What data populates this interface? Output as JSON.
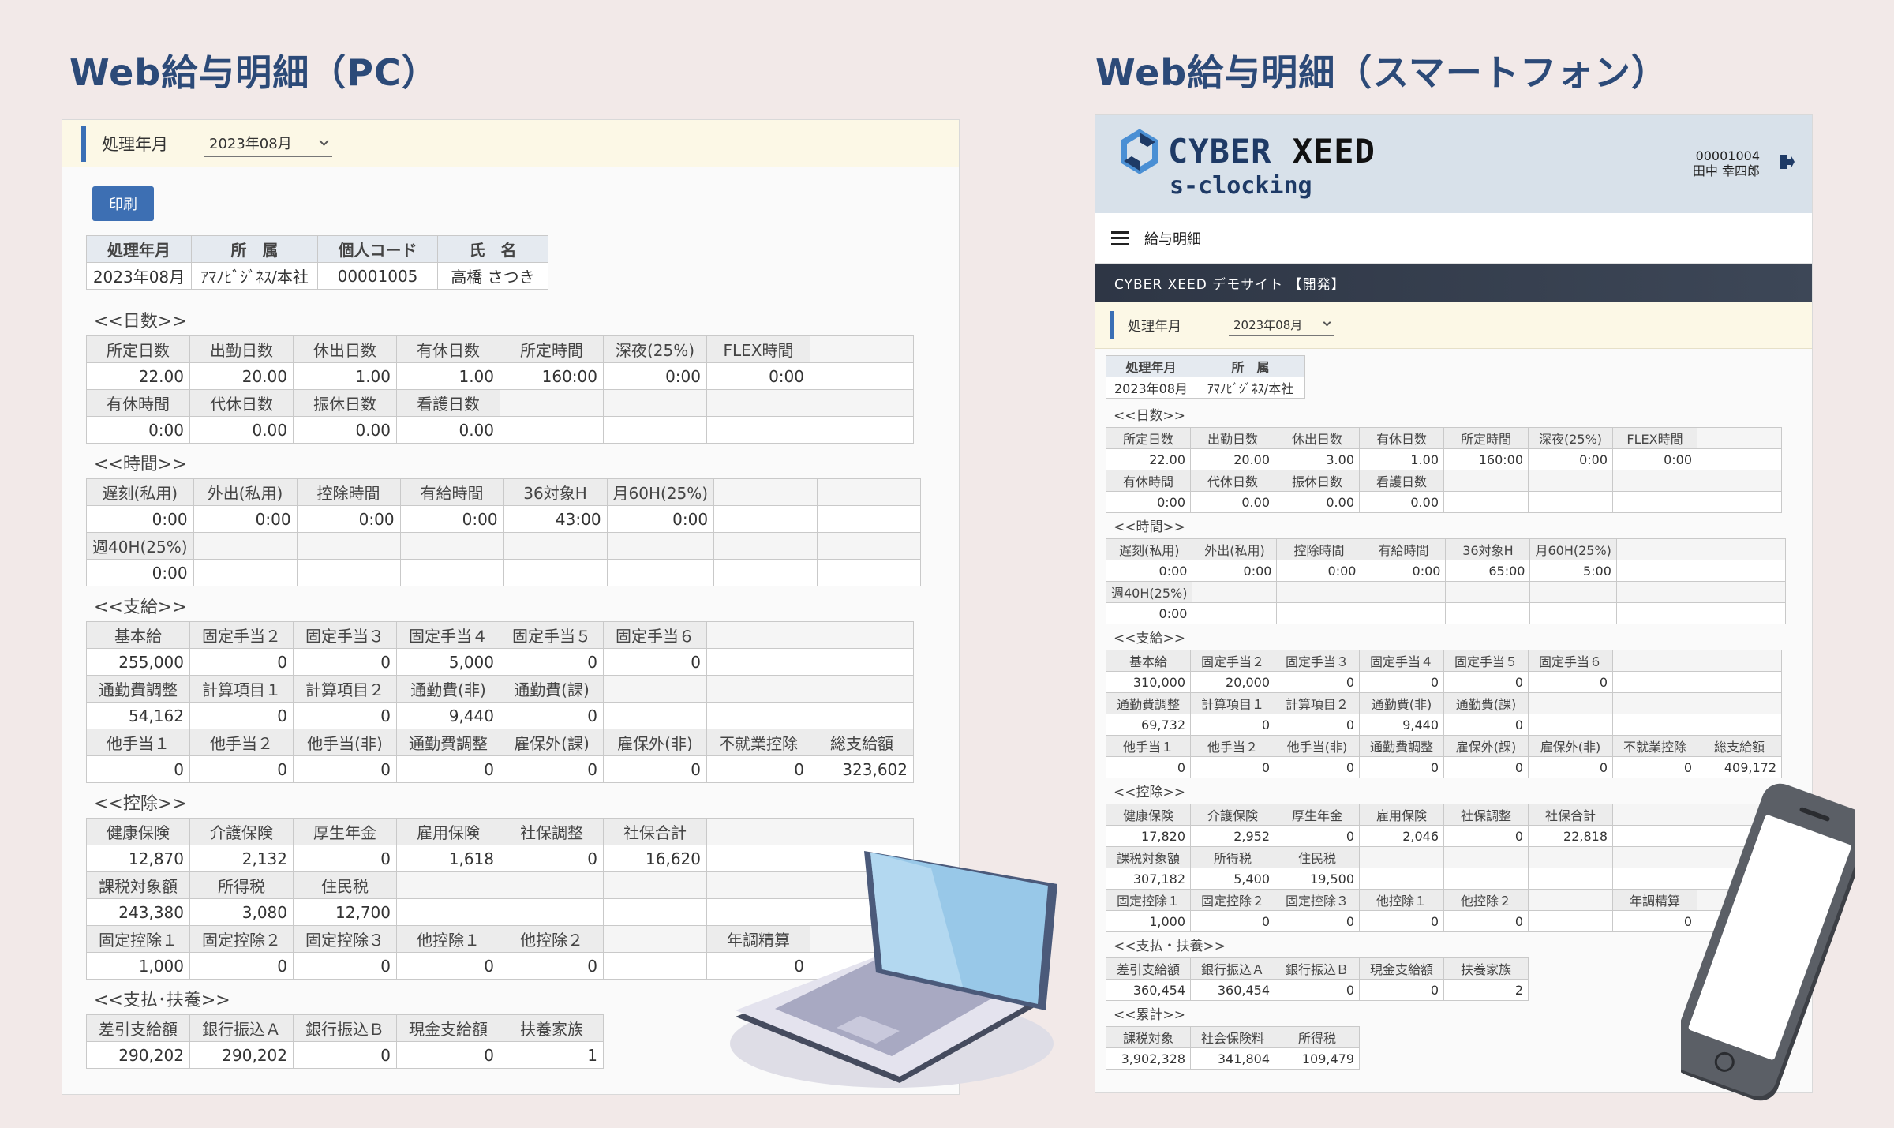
{
  "headings": {
    "pc": "Web給与明細（PC）",
    "sp": "Web給与明細（スマートフォン）"
  },
  "pc": {
    "period_label": "処理年月",
    "period_value": "2023年08月",
    "print_button": "印刷",
    "info": {
      "headers": [
        "処理年月",
        "所　属",
        "個人コード",
        "氏　名"
      ],
      "values": [
        "2023年08月",
        "ｱﾏﾉﾋﾞｼﾞﾈｽ/本社",
        "00001005",
        "高橋 さつき"
      ]
    },
    "sections": [
      {
        "title": "<<日数>>",
        "rows": [
          [
            "所定日数",
            "出勤日数",
            "休出日数",
            "有休日数",
            "所定時間",
            "深夜(25%)",
            "FLEX時間",
            ""
          ],
          [
            "22.00",
            "20.00",
            "1.00",
            "1.00",
            "160:00",
            "0:00",
            "0:00",
            ""
          ],
          [
            "有休時間",
            "代休日数",
            "振休日数",
            "看護日数",
            "",
            "",
            "",
            ""
          ],
          [
            "0:00",
            "0.00",
            "0.00",
            "0.00",
            "",
            "",
            "",
            ""
          ]
        ]
      },
      {
        "title": "<<時間>>",
        "rows": [
          [
            "遅刻(私用)",
            "外出(私用)",
            "控除時間",
            "有給時間",
            "36対象H",
            "月60H(25%)",
            "",
            ""
          ],
          [
            "0:00",
            "0:00",
            "0:00",
            "0:00",
            "43:00",
            "0:00",
            "",
            ""
          ],
          [
            "週40H(25%)",
            "",
            "",
            "",
            "",
            "",
            "",
            ""
          ],
          [
            "0:00",
            "",
            "",
            "",
            "",
            "",
            "",
            ""
          ]
        ]
      },
      {
        "title": "<<支給>>",
        "rows": [
          [
            "基本給",
            "固定手当２",
            "固定手当３",
            "固定手当４",
            "固定手当５",
            "固定手当６",
            "",
            ""
          ],
          [
            "255,000",
            "0",
            "0",
            "5,000",
            "0",
            "0",
            "",
            ""
          ],
          [
            "通勤費調整",
            "計算項目１",
            "計算項目２",
            "通勤費(非)",
            "通勤費(課)",
            "",
            "",
            ""
          ],
          [
            "54,162",
            "0",
            "0",
            "9,440",
            "0",
            "",
            "",
            ""
          ],
          [
            "他手当１",
            "他手当２",
            "他手当(非)",
            "通勤費調整",
            "雇保外(課)",
            "雇保外(非)",
            "不就業控除",
            "総支給額"
          ],
          [
            "0",
            "0",
            "0",
            "0",
            "0",
            "0",
            "0",
            "323,602"
          ]
        ]
      },
      {
        "title": "<<控除>>",
        "rows": [
          [
            "健康保険",
            "介護保険",
            "厚生年金",
            "雇用保険",
            "社保調整",
            "社保合計",
            "",
            ""
          ],
          [
            "12,870",
            "2,132",
            "0",
            "1,618",
            "0",
            "16,620",
            "",
            ""
          ],
          [
            "課税対象額",
            "所得税",
            "住民税",
            "",
            "",
            "",
            "",
            ""
          ],
          [
            "243,380",
            "3,080",
            "12,700",
            "",
            "",
            "",
            "",
            ""
          ],
          [
            "固定控除１",
            "固定控除２",
            "固定控除３",
            "他控除１",
            "他控除２",
            "",
            "年調精算",
            ""
          ],
          [
            "1,000",
            "0",
            "0",
            "0",
            "0",
            "",
            "0",
            ""
          ]
        ]
      },
      {
        "title": "<<支払･扶養>>",
        "rows": [
          [
            "差引支給額",
            "銀行振込Ａ",
            "銀行振込Ｂ",
            "現金支給額",
            "扶養家族"
          ],
          [
            "290,202",
            "290,202",
            "0",
            "0",
            "1"
          ]
        ]
      }
    ]
  },
  "sp": {
    "logo_main": "CYBER",
    "logo_accent": "XEED",
    "logo_sub": "s-clocking",
    "user_code": "00001004",
    "user_name": "田中 幸四郎",
    "menu_title": "給与明細",
    "site_name": "CYBER XEED デモサイト 【開発】",
    "period_label": "処理年月",
    "period_value": "2023年08月",
    "info": {
      "headers": [
        "処理年月",
        "所　属"
      ],
      "values": [
        "2023年08月",
        "ｱﾏﾉﾋﾞｼﾞﾈｽ/本社"
      ]
    },
    "sections": [
      {
        "title": "<<日数>>",
        "rows": [
          [
            "所定日数",
            "出勤日数",
            "休出日数",
            "有休日数",
            "所定時間",
            "深夜(25%)",
            "FLEX時間",
            ""
          ],
          [
            "22.00",
            "20.00",
            "3.00",
            "1.00",
            "160:00",
            "0:00",
            "0:00",
            ""
          ],
          [
            "有休時間",
            "代休日数",
            "振休日数",
            "看護日数",
            "",
            "",
            "",
            ""
          ],
          [
            "0:00",
            "0.00",
            "0.00",
            "0.00",
            "",
            "",
            "",
            ""
          ]
        ]
      },
      {
        "title": "<<時間>>",
        "rows": [
          [
            "遅刻(私用)",
            "外出(私用)",
            "控除時間",
            "有給時間",
            "36対象H",
            "月60H(25%)",
            "",
            ""
          ],
          [
            "0:00",
            "0:00",
            "0:00",
            "0:00",
            "65:00",
            "5:00",
            "",
            ""
          ],
          [
            "週40H(25%)",
            "",
            "",
            "",
            "",
            "",
            "",
            ""
          ],
          [
            "0:00",
            "",
            "",
            "",
            "",
            "",
            "",
            ""
          ]
        ]
      },
      {
        "title": "<<支給>>",
        "rows": [
          [
            "基本給",
            "固定手当２",
            "固定手当３",
            "固定手当４",
            "固定手当５",
            "固定手当６",
            "",
            ""
          ],
          [
            "310,000",
            "20,000",
            "0",
            "0",
            "0",
            "0",
            "",
            ""
          ],
          [
            "通勤費調整",
            "計算項目１",
            "計算項目２",
            "通勤費(非)",
            "通勤費(課)",
            "",
            "",
            ""
          ],
          [
            "69,732",
            "0",
            "0",
            "9,440",
            "0",
            "",
            "",
            ""
          ],
          [
            "他手当１",
            "他手当２",
            "他手当(非)",
            "通勤費調整",
            "雇保外(課)",
            "雇保外(非)",
            "不就業控除",
            "総支給額"
          ],
          [
            "0",
            "0",
            "0",
            "0",
            "0",
            "0",
            "0",
            "409,172"
          ]
        ]
      },
      {
        "title": "<<控除>>",
        "rows": [
          [
            "健康保険",
            "介護保険",
            "厚生年金",
            "雇用保険",
            "社保調整",
            "社保合計",
            "",
            ""
          ],
          [
            "17,820",
            "2,952",
            "0",
            "2,046",
            "0",
            "22,818",
            "",
            ""
          ],
          [
            "課税対象額",
            "所得税",
            "住民税",
            "",
            "",
            "",
            "",
            ""
          ],
          [
            "307,182",
            "5,400",
            "19,500",
            "",
            "",
            "",
            "",
            ""
          ],
          [
            "固定控除１",
            "固定控除２",
            "固定控除３",
            "他控除１",
            "他控除２",
            "",
            "年調精算",
            ""
          ],
          [
            "1,000",
            "0",
            "0",
            "0",
            "0",
            "",
            "0",
            ""
          ]
        ]
      },
      {
        "title": "<<支払・扶養>>",
        "rows": [
          [
            "差引支給額",
            "銀行振込Ａ",
            "銀行振込Ｂ",
            "現金支給額",
            "扶養家族"
          ],
          [
            "360,454",
            "360,454",
            "0",
            "0",
            "2"
          ]
        ]
      },
      {
        "title": "<<累計>>",
        "rows": [
          [
            "課税対象",
            "社会保険料",
            "所得税"
          ],
          [
            "3,902,328",
            "341,804",
            "109,479"
          ]
        ]
      }
    ]
  }
}
